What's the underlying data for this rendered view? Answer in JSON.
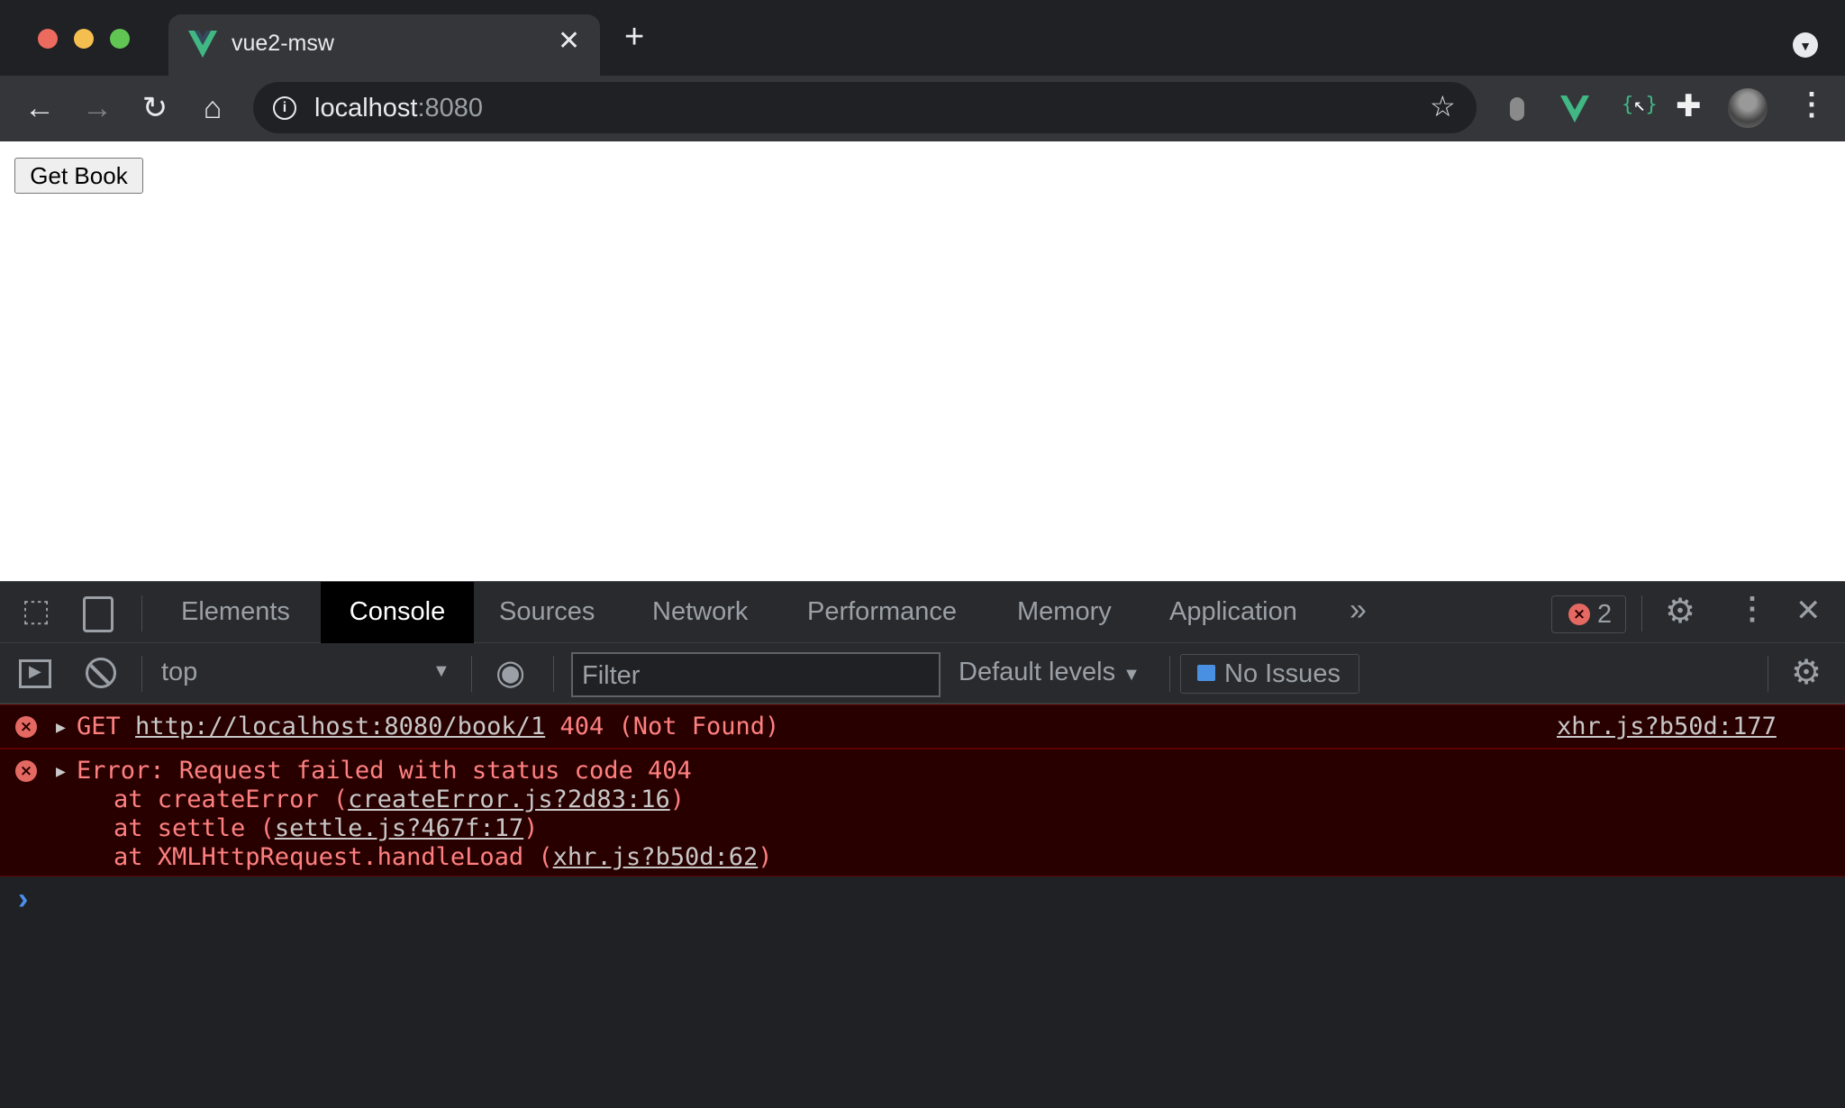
{
  "browser": {
    "tab_title": "vue2-msw",
    "url_host": "localhost",
    "url_port": ":8080",
    "colors": {
      "close": "#ed6a5e",
      "minimize": "#f5bf4f",
      "maximize": "#61c554",
      "vue_green": "#41b883"
    }
  },
  "page": {
    "get_book_label": "Get Book"
  },
  "devtools": {
    "tabs": [
      "Elements",
      "Console",
      "Sources",
      "Network",
      "Performance",
      "Memory",
      "Application"
    ],
    "active_tab": "Console",
    "error_count": "2",
    "context": "top",
    "filter_placeholder": "Filter",
    "levels": "Default levels",
    "issues": "No Issues"
  },
  "console": {
    "row1": {
      "method": "GET",
      "url": "http://localhost:8080/book/1",
      "status": "404 (Not Found)",
      "source": "xhr.js?b50d:177"
    },
    "row2": {
      "message": "Error: Request failed with status code 404",
      "stack": [
        {
          "prefix": "at createError (",
          "link": "createError.js?2d83:16",
          "suffix": ")"
        },
        {
          "prefix": "at settle (",
          "link": "settle.js?467f:17",
          "suffix": ")"
        },
        {
          "prefix": "at XMLHttpRequest.handleLoad (",
          "link": "xhr.js?b50d:62",
          "suffix": ")"
        }
      ]
    },
    "prompt": "›"
  }
}
